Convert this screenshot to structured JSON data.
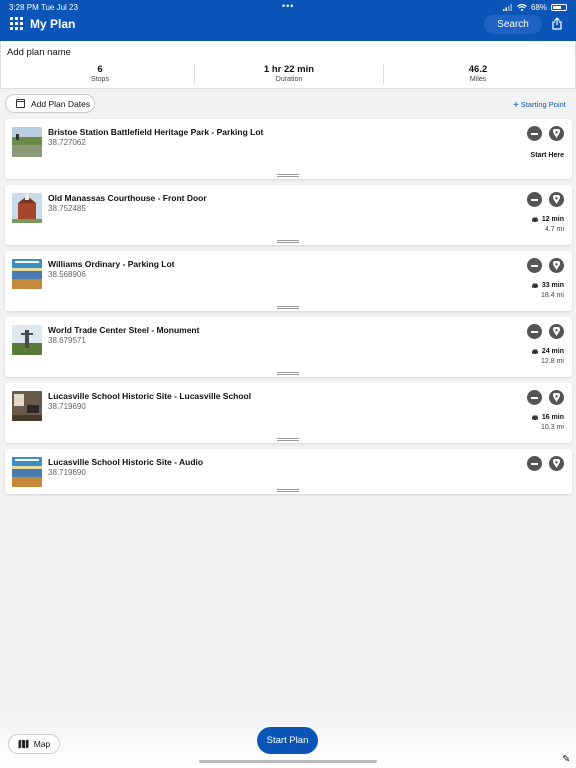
{
  "status_bar": {
    "time": "3:28 PM  Tue Jul 23",
    "dots": "•••",
    "battery": "68%"
  },
  "header": {
    "title": "My Plan",
    "search_label": "Search"
  },
  "summary": {
    "plan_name_placeholder": "Add plan name",
    "stats": [
      {
        "value": "6",
        "label": "Stops"
      },
      {
        "value": "1 hr 22 min",
        "label": "Duration"
      },
      {
        "value": "46.2",
        "label": "Miles"
      }
    ]
  },
  "toolbar": {
    "add_dates_label": "Add Plan Dates",
    "starting_point_label": "Starting Point"
  },
  "stops": [
    {
      "name": "Bristoe Station Battlefield Heritage Park - Parking Lot",
      "coord": "38.727062",
      "start_label": "Start Here",
      "thumb": "field"
    },
    {
      "name": "Old Manassas Courthouse - Front Door",
      "coord": "38.752485",
      "time": "12 min",
      "distance": "4.7 mi",
      "thumb": "building"
    },
    {
      "name": "Williams Ordinary - Parking Lot",
      "coord": "38.568906",
      "time": "33 min",
      "distance": "18.4 mi",
      "thumb": "poster"
    },
    {
      "name": "World Trade Center Steel - Monument",
      "coord": "38.679571",
      "time": "24 min",
      "distance": "12.8 mi",
      "thumb": "monument"
    },
    {
      "name": "Lucasville School Historic Site - Lucasville School",
      "coord": "38.719690",
      "time": "16 min",
      "distance": "10.3 mi",
      "thumb": "interior"
    },
    {
      "name": "Lucasville School Historic Site - Audio",
      "coord": "38.719690",
      "thumb": "poster"
    }
  ],
  "bottom": {
    "map_label": "Map",
    "start_plan_label": "Start Plan"
  },
  "colors": {
    "brand_blue": "#0b55b8",
    "button_gray": "#555555"
  }
}
